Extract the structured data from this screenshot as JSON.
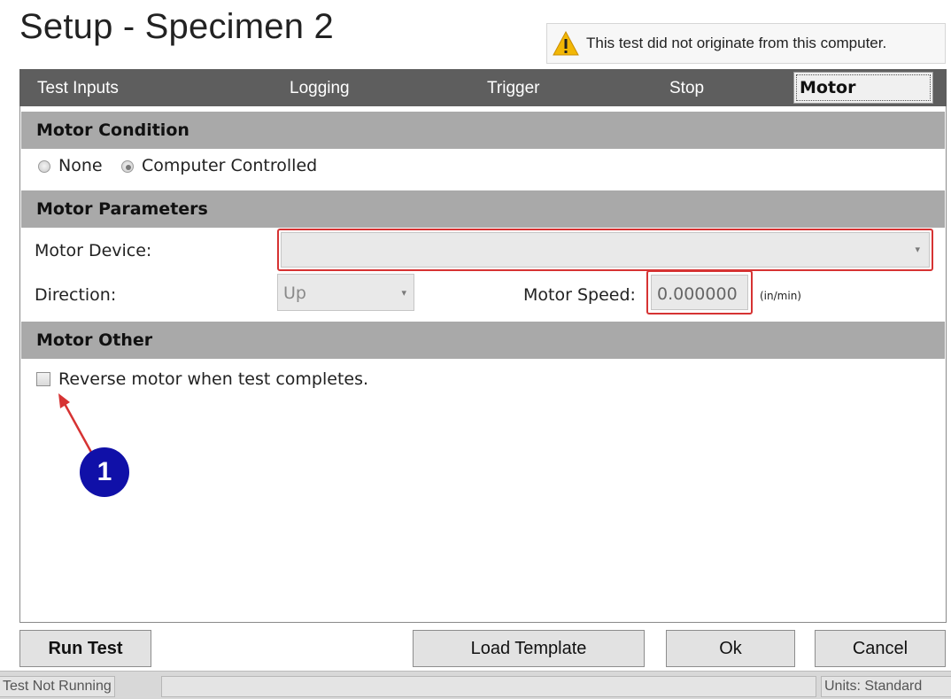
{
  "window": {
    "title": "Setup - Specimen 2",
    "warning_text": "This test did not originate from this computer."
  },
  "tabs": [
    {
      "label": "Test Inputs",
      "active": false
    },
    {
      "label": "Logging",
      "active": false
    },
    {
      "label": "Trigger",
      "active": false
    },
    {
      "label": "Stop",
      "active": false
    },
    {
      "label": "Motor",
      "active": true
    }
  ],
  "motor_condition": {
    "header": "Motor Condition",
    "options": [
      {
        "label": "None",
        "selected": false
      },
      {
        "label": "Computer Controlled",
        "selected": true
      }
    ]
  },
  "motor_parameters": {
    "header": "Motor Parameters",
    "device_label": "Motor Device:",
    "device_value": "",
    "direction_label": "Direction:",
    "direction_value": "Up",
    "speed_label": "Motor Speed:",
    "speed_value": "0.000000",
    "speed_unit": "(in/min)"
  },
  "motor_other": {
    "header": "Motor Other",
    "reverse_label": "Reverse motor when test completes.",
    "reverse_checked": false
  },
  "annotation": {
    "callout_number": "1",
    "highlight_color": "#d63333",
    "callout_color": "#1010a8"
  },
  "buttons": {
    "run_test": "Run Test",
    "load_template": "Load Template",
    "ok": "Ok",
    "cancel": "Cancel"
  },
  "status_bar": {
    "state": "Test Not Running",
    "units": "Units:  Standard"
  }
}
